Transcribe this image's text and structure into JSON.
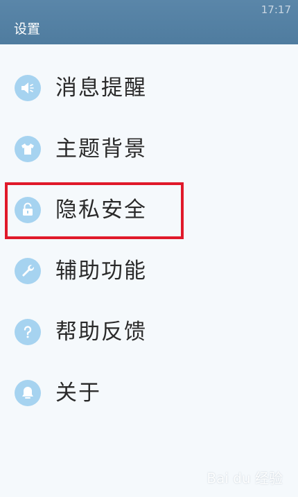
{
  "status_bar": {
    "time": "17:17"
  },
  "header": {
    "title": "设置"
  },
  "menu": {
    "items": [
      {
        "label": "消息提醒",
        "icon": "speaker-icon"
      },
      {
        "label": "主题背景",
        "icon": "shirt-icon"
      },
      {
        "label": "隐私安全",
        "icon": "lock-icon"
      },
      {
        "label": "辅助功能",
        "icon": "wrench-icon"
      },
      {
        "label": "帮助反馈",
        "icon": "question-icon"
      },
      {
        "label": "关于",
        "icon": "bell-icon"
      }
    ]
  },
  "annotation": {
    "highlight_color": "#e0192a",
    "target_item": "隐私安全"
  },
  "watermark": {
    "text": "Bai du 经验"
  },
  "colors": {
    "header": "#5a86a9",
    "icon_circle": "#a6d3f0",
    "background": "#f5f9fc"
  }
}
